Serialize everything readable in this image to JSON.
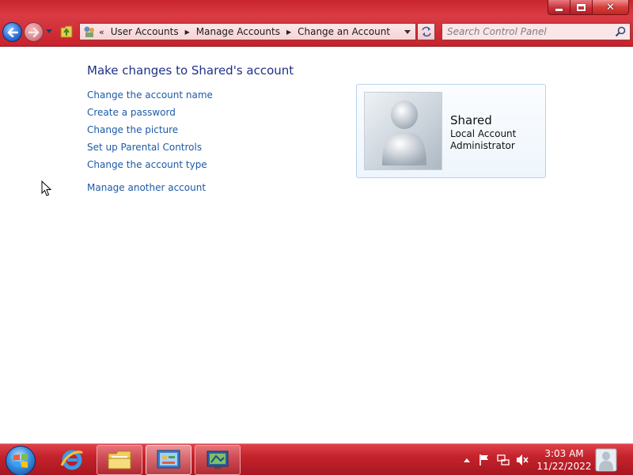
{
  "window": {
    "caption": {
      "minimize_icon": "minimize-icon",
      "maximize_icon": "maximize-icon",
      "close_glyph": "✕"
    }
  },
  "toolbar": {
    "breadcrumb_overflow": "«",
    "breadcrumbs": [
      "User Accounts",
      "Manage Accounts",
      "Change an Account"
    ],
    "search_placeholder": "Search Control Panel"
  },
  "content": {
    "title": "Make changes to Shared's account",
    "tasks": [
      "Change the account name",
      "Create a password",
      "Change the picture",
      "Set up Parental Controls",
      "Change the account type"
    ],
    "manage_other": "Manage another account"
  },
  "account": {
    "name": "Shared",
    "type": "Local Account",
    "role": "Administrator"
  },
  "taskbar": {
    "time": "3:03 AM",
    "date": "11/22/2022"
  },
  "colors": {
    "accent_red": "#c8252e",
    "link_blue": "#1e5aa8",
    "title_blue": "#1e3287",
    "card_border": "#b9d1ea"
  }
}
